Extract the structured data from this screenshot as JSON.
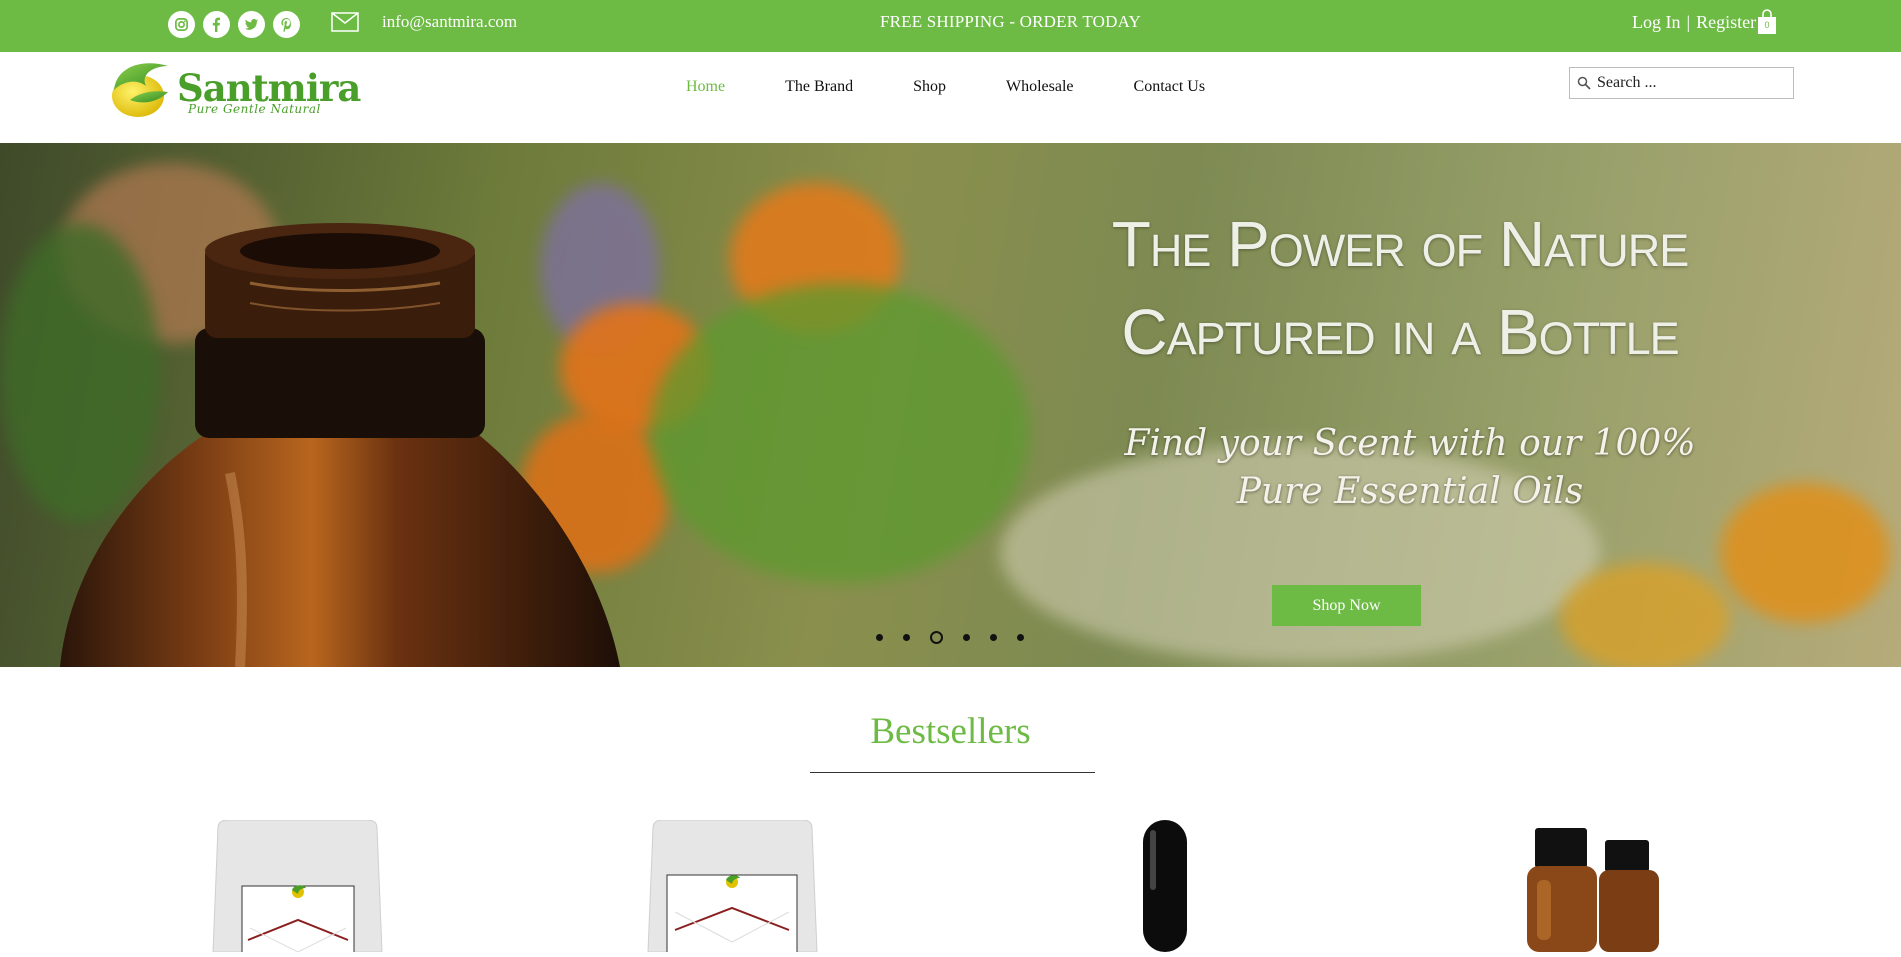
{
  "topbar": {
    "social_icons": [
      "instagram-icon",
      "facebook-icon",
      "twitter-icon",
      "pinterest-icon"
    ],
    "email": "info@santmira.com",
    "promo": "FREE SHIPPING - ORDER TODAY",
    "login": "Log In",
    "separator": "|",
    "register": "Register",
    "cart_count": "0"
  },
  "header": {
    "brand": "Santmira",
    "tagline": "Pure Gentle Natural",
    "nav": [
      "Home",
      "The Brand",
      "Shop",
      "Wholesale",
      "Contact Us"
    ],
    "active_nav": "Home",
    "search_placeholder": "Search ..."
  },
  "hero": {
    "title_line1": "The Power of Nature",
    "title_line2": "Captured in a Bottle",
    "subtitle_line1": "Find your Scent with our 100%",
    "subtitle_line2": "Pure Essential Oils",
    "cta": "Shop Now",
    "slide_count": 6,
    "active_slide": 3
  },
  "bestsellers": {
    "title": "Bestsellers"
  },
  "colors": {
    "brand_green": "#6dbb45",
    "text_dark": "#111111"
  }
}
